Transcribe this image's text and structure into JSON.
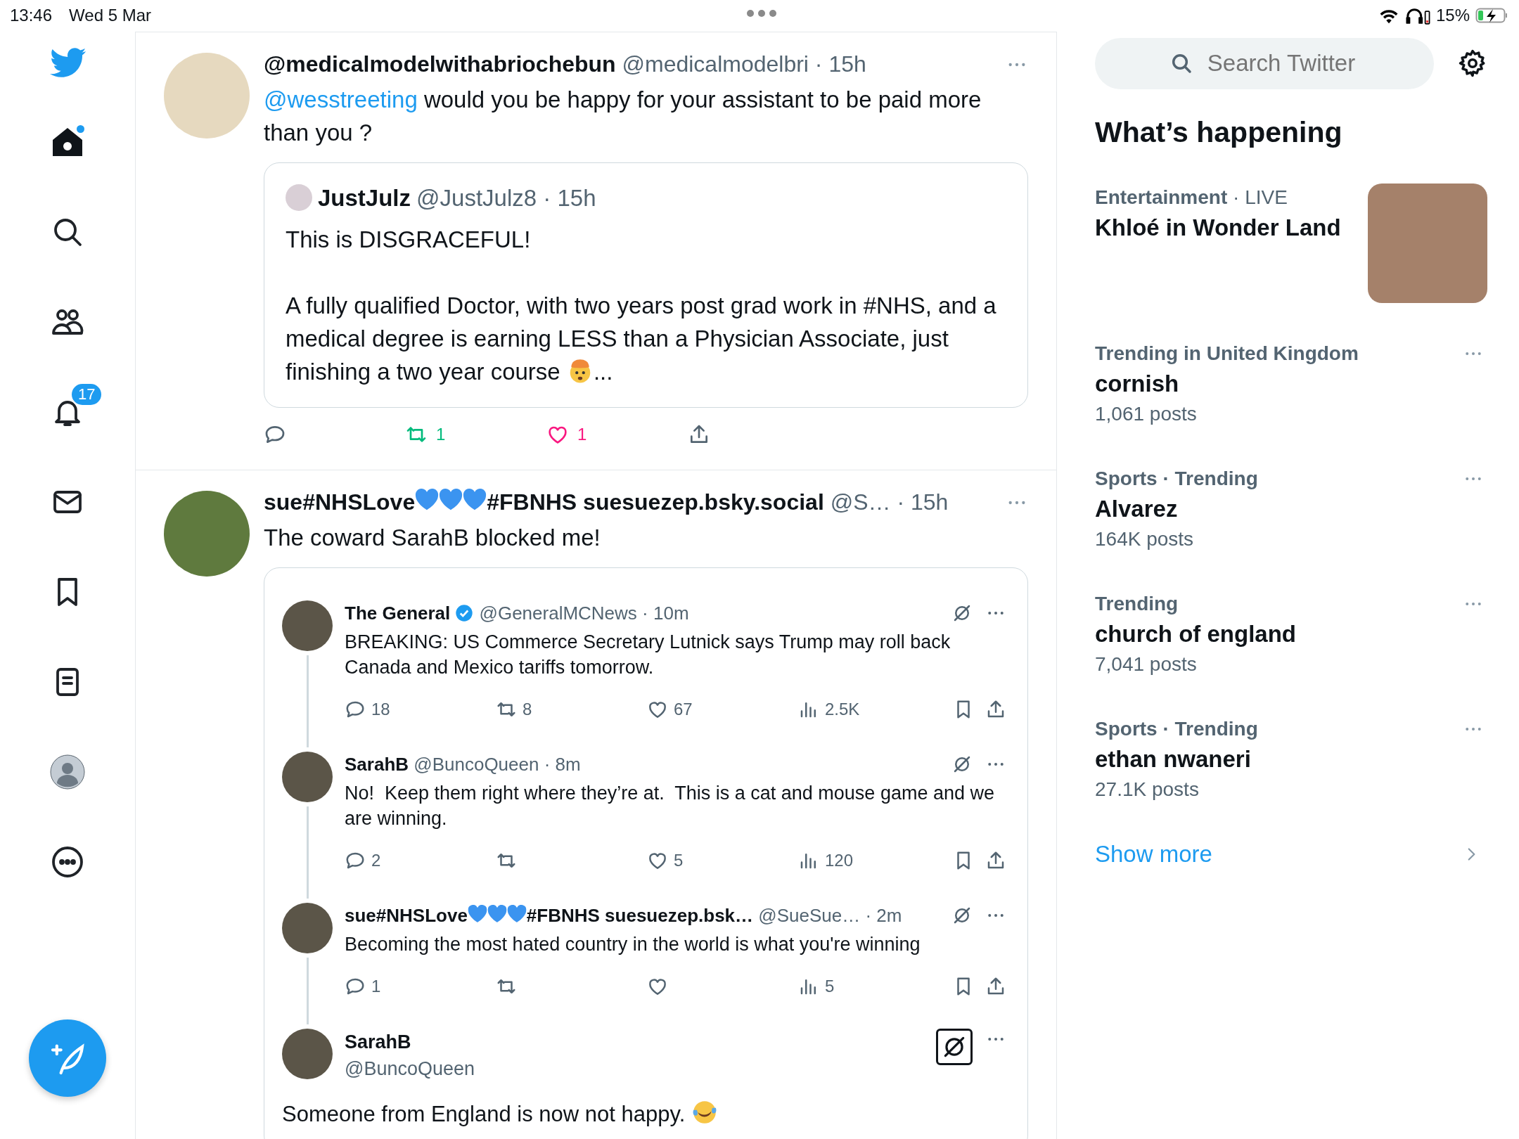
{
  "status_bar": {
    "time": "13:46",
    "date": "Wed 5 Mar",
    "battery": "15%"
  },
  "nav": {
    "items": [
      {
        "kind": "home",
        "selected": true,
        "dot": true
      },
      {
        "kind": "explore",
        "selected": false
      },
      {
        "kind": "communities",
        "selected": false
      },
      {
        "kind": "notifications",
        "selected": false,
        "badge": "17"
      },
      {
        "kind": "messages",
        "selected": false
      },
      {
        "kind": "bookmarks",
        "selected": false
      },
      {
        "kind": "lists",
        "selected": false
      },
      {
        "kind": "profile",
        "selected": false
      },
      {
        "kind": "more",
        "selected": false
      }
    ]
  },
  "tweets": [
    {
      "author": [
        {
          "kind": "text",
          "text": "@medicalmodelwithabriochebun"
        }
      ],
      "meta": "@medicalmodelbri · 15h",
      "body": [
        [
          {
            "kind": "mention",
            "text": "@wesstreeting"
          },
          {
            "kind": "text",
            "text": " would you be happy for your assistant to be paid more than you ?"
          }
        ]
      ],
      "quote": {
        "author": "JustJulz",
        "meta": "@JustJulz8 · 15h",
        "body": [
          [
            {
              "kind": "text",
              "text": "This is DISGRACEFUL!"
            }
          ],
          [
            {
              "kind": "text",
              "text": "A fully qualified Doctor, with two years post grad work in #NHS, and a medical degree is earning LESS than a Physician Associate, just finishing a two year course "
            },
            {
              "kind": "exploding-head"
            },
            {
              "kind": "text",
              "text": "..."
            }
          ]
        ]
      },
      "actions": [
        {
          "kind": "reply"
        },
        {
          "kind": "retweet",
          "count": "1",
          "active": true
        },
        {
          "kind": "like",
          "count": "1",
          "active": true
        },
        {
          "kind": "share"
        }
      ]
    },
    {
      "author": [
        {
          "kind": "text",
          "text": "sue#NHSLove"
        },
        {
          "kind": "heart"
        },
        {
          "kind": "heart"
        },
        {
          "kind": "heart"
        },
        {
          "kind": "text",
          "text": "#FBNHS suesuezep.bsky.social"
        }
      ],
      "meta": "@S… · 15h",
      "body": [
        [
          {
            "kind": "text",
            "text": "The coward SarahB blocked me!"
          }
        ]
      ],
      "thread": [
        {
          "kind": "inline",
          "author": [
            {
              "kind": "text",
              "text": "The General"
            }
          ],
          "verified": true,
          "meta": "@GeneralMCNews · 10m",
          "grok_boxed": false,
          "body": [
            {
              "kind": "text",
              "text": "BREAKING: US Commerce Secretary Lutnick says Trump may roll back Canada and Mexico tariffs tomorrow."
            }
          ],
          "actions": [
            {
              "kind": "reply",
              "count": "18"
            },
            {
              "kind": "retweet",
              "count": "8",
              "active": false
            },
            {
              "kind": "like",
              "count": "67",
              "active": false
            },
            {
              "kind": "views",
              "count": "2.5K"
            },
            {
              "kind": "bookmark"
            },
            {
              "kind": "share"
            }
          ]
        },
        {
          "kind": "inline",
          "author": [
            {
              "kind": "text",
              "text": "SarahB"
            }
          ],
          "verified": false,
          "meta": "@BuncoQueen · 8m",
          "grok_boxed": false,
          "body": [
            {
              "kind": "text",
              "text": "No!  Keep them right where they’re at.  This is a cat and mouse game and we are winning."
            }
          ],
          "actions": [
            {
              "kind": "reply",
              "count": "2"
            },
            {
              "kind": "retweet",
              "active": false
            },
            {
              "kind": "like",
              "count": "5",
              "active": false
            },
            {
              "kind": "views",
              "count": "120"
            },
            {
              "kind": "bookmark"
            },
            {
              "kind": "share"
            }
          ]
        },
        {
          "kind": "inline",
          "author": [
            {
              "kind": "text",
              "text": "sue#NHSLove"
            },
            {
              "kind": "heart"
            },
            {
              "kind": "heart"
            },
            {
              "kind": "heart"
            },
            {
              "kind": "text",
              "text": "#FBNHS suesuezep.bsk…"
            }
          ],
          "verified": false,
          "meta": "@SueSue… · 2m",
          "grok_boxed": false,
          "body": [
            {
              "kind": "text",
              "text": "Becoming the most hated country in the world is what you're winning"
            }
          ],
          "actions": [
            {
              "kind": "reply",
              "count": "1"
            },
            {
              "kind": "retweet",
              "active": false
            },
            {
              "kind": "like",
              "active": false
            },
            {
              "kind": "views",
              "count": "5"
            },
            {
              "kind": "bookmark"
            },
            {
              "kind": "share"
            }
          ]
        },
        {
          "kind": "stacked",
          "author": [
            {
              "kind": "text",
              "text": "SarahB"
            }
          ],
          "verified": false,
          "meta": "@BuncoQueen",
          "grok_boxed": true,
          "body": [
            {
              "kind": "text",
              "text": "Someone from England is now not happy. "
            },
            {
              "kind": "laughing"
            }
          ]
        }
      ]
    }
  ],
  "sidebar": {
    "search": {
      "placeholder": "Search Twitter"
    },
    "heading": "What’s happening",
    "trends": [
      {
        "kind": "featured",
        "category": "**Entertainment** · LIVE",
        "title": "Khloé in Wonder Land"
      },
      {
        "kind": "trend",
        "category": "**Trending in United Kingdom**",
        "title": "cornish",
        "posts": "1,061 posts"
      },
      {
        "kind": "trend",
        "category": "**Sports · Trending**",
        "title": "Alvarez",
        "posts": "164K posts"
      },
      {
        "kind": "trend",
        "category": "**Trending**",
        "title": "church of england",
        "posts": "7,041 posts"
      },
      {
        "kind": "trend",
        "category": "**Sports · Trending**",
        "title": "ethan nwaneri",
        "posts": "27.1K posts"
      }
    ],
    "show_more": "Show more"
  }
}
